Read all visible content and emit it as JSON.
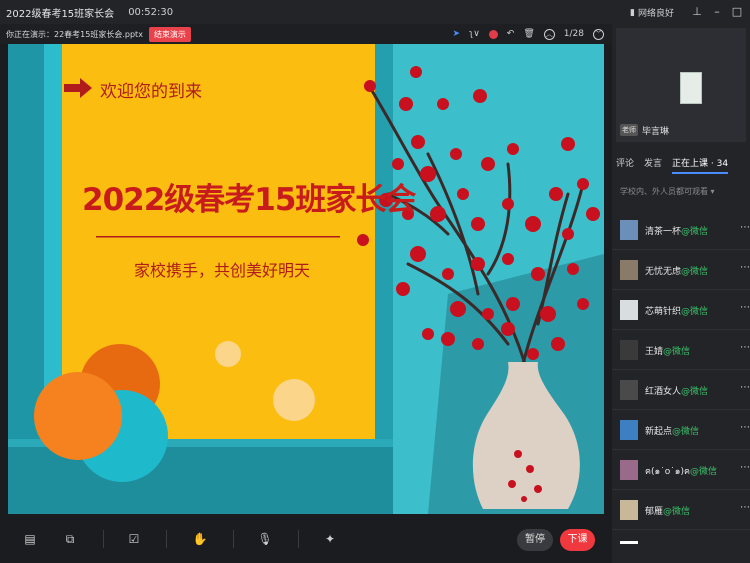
{
  "titlebar": {
    "title": "2022级春考15班家长会",
    "timer": "00:52:30",
    "network": "网络良好"
  },
  "present": {
    "file_label": "你正在演示：22春考15班家长会.pptx",
    "end_button": "结束演示",
    "page": "1/28"
  },
  "slide": {
    "welcome": "欢迎您的到来",
    "title": "2022级春考15班家长会",
    "subtitle": "家校携手，共创美好明天"
  },
  "bottom": {
    "pause": "暂停",
    "end_class": "下课"
  },
  "teacher": {
    "role": "老师",
    "name": "毕言琳"
  },
  "tabs": {
    "comments": "评论",
    "speak": "发言",
    "in_class": "正在上课 · 34"
  },
  "viewers_note": "学校内、外人员都可观看",
  "viewers": [
    {
      "name": "清茶一杯",
      "source": "@微信",
      "avatar_color": "#6b8fb8"
    },
    {
      "name": "无忧无虑",
      "source": "@微信",
      "avatar_color": "#8a7a6a"
    },
    {
      "name": "芯萌针织",
      "source": "@微信",
      "avatar_color": "#d8dde0"
    },
    {
      "name": "王婧",
      "source": "@微信",
      "avatar_color": "#3a3a3a"
    },
    {
      "name": "红酒女人",
      "source": "@微信",
      "avatar_color": "#4a4a4a"
    },
    {
      "name": "新起点",
      "source": "@微信",
      "avatar_color": "#3d7fc0"
    },
    {
      "name": "ฅ(๑˙o˙๑)ฅ",
      "source": "@微信",
      "avatar_color": "#9a6a8a"
    },
    {
      "name": "郁雁",
      "source": "@微信",
      "avatar_color": "#c8b89a"
    }
  ]
}
